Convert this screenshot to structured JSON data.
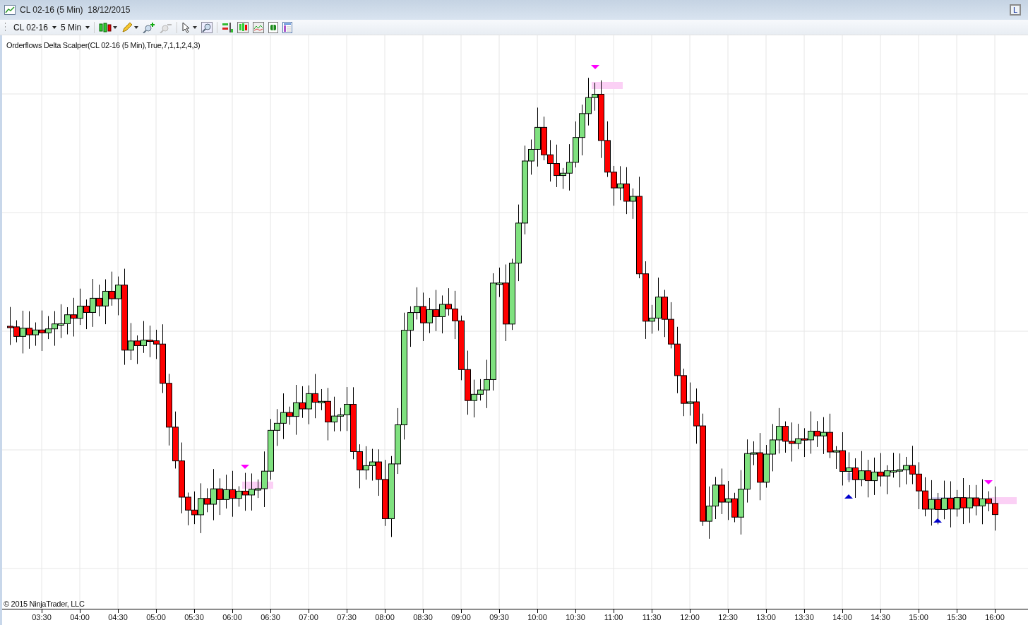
{
  "window": {
    "title": "CL 02-16 (5 Min)  18/12/2015",
    "corner_button": "L"
  },
  "toolbar": {
    "instrument": "CL 02-16",
    "interval": "5 Min"
  },
  "chart": {
    "indicator_label": "Orderflows Delta Scalper(CL 02-16 (5 Min),True,7,1,1,2,4,3)",
    "copyright": "© 2015 NinjaTrader, LLC",
    "x_labels": [
      "03:30",
      "04:00",
      "04:30",
      "05:00",
      "05:30",
      "06:00",
      "06:30",
      "07:00",
      "07:30",
      "08:00",
      "08:30",
      "09:00",
      "09:30",
      "10:00",
      "10:30",
      "11:00",
      "11:30",
      "12:00",
      "12:30",
      "13:00",
      "13:30",
      "14:00",
      "14:30",
      "15:00",
      "15:30",
      "16:00"
    ]
  }
}
